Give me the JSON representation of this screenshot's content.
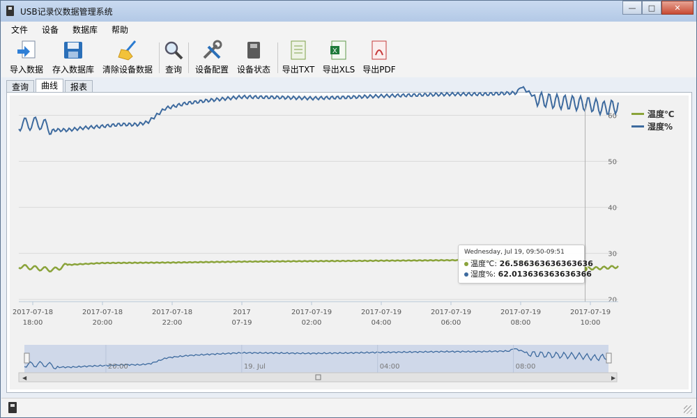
{
  "window": {
    "title": "USB记录仪数据管理系统"
  },
  "menu": [
    "文件",
    "设备",
    "数据库",
    "帮助"
  ],
  "toolbar": {
    "import": "导入数据",
    "save_db": "存入数据库",
    "clear": "清除设备数据",
    "query": "查询",
    "config": "设备配置",
    "status": "设备状态",
    "export_txt": "导出TXT",
    "export_xls": "导出XLS",
    "export_pdf": "导出PDF"
  },
  "tabs": [
    "查询",
    "曲线",
    "报表"
  ],
  "active_tab": "曲线",
  "colors": {
    "temperature": "#8aa33a",
    "humidity": "#3d6a9e"
  },
  "chart_data": {
    "type": "line",
    "series": [
      {
        "name": "温度℃",
        "color": "#8aa33a"
      },
      {
        "name": "湿度%",
        "color": "#3d6a9e"
      }
    ],
    "y_axis": {
      "ticks": [
        20,
        30,
        40,
        50,
        60
      ]
    },
    "x_axis": {
      "ticks": [
        {
          "date": "2017-07-18",
          "time": "18:00"
        },
        {
          "date": "2017-07-18",
          "time": "20:00"
        },
        {
          "date": "2017-07-18",
          "time": "22:00"
        },
        {
          "date": "2017",
          "time": "07-19"
        },
        {
          "date": "2017-07-19",
          "time": "02:00"
        },
        {
          "date": "2017-07-19",
          "time": "04:00"
        },
        {
          "date": "2017-07-19",
          "time": "06:00"
        },
        {
          "date": "2017-07-19",
          "time": "08:00"
        },
        {
          "date": "2017-07-19",
          "time": "10:00"
        }
      ]
    },
    "humidity_samples": [
      {
        "t": 17.6,
        "v": 58
      },
      {
        "t": 18.2,
        "v": 58.3
      },
      {
        "t": 18.6,
        "v": 56.8
      },
      {
        "t": 19.0,
        "v": 56.8
      },
      {
        "t": 19.5,
        "v": 57.3
      },
      {
        "t": 20.0,
        "v": 57.6
      },
      {
        "t": 20.5,
        "v": 58.0
      },
      {
        "t": 21.0,
        "v": 58.0
      },
      {
        "t": 21.3,
        "v": 58.5
      },
      {
        "t": 21.8,
        "v": 61.5
      },
      {
        "t": 22.4,
        "v": 62.6
      },
      {
        "t": 23.0,
        "v": 63.2
      },
      {
        "t": 24.0,
        "v": 64.0
      },
      {
        "t": 25.0,
        "v": 63.9
      },
      {
        "t": 26.0,
        "v": 63.7
      },
      {
        "t": 27.0,
        "v": 63.9
      },
      {
        "t": 28.0,
        "v": 64.2
      },
      {
        "t": 29.0,
        "v": 64.4
      },
      {
        "t": 30.0,
        "v": 64.6
      },
      {
        "t": 31.0,
        "v": 64.6
      },
      {
        "t": 31.9,
        "v": 64.9
      },
      {
        "t": 32.0,
        "v": 66.3
      },
      {
        "t": 32.5,
        "v": 63.5
      },
      {
        "t": 33.0,
        "v": 63.0
      },
      {
        "t": 33.5,
        "v": 62.7
      },
      {
        "t": 34.0,
        "v": 62.4
      },
      {
        "t": 34.4,
        "v": 61.5
      },
      {
        "t": 34.8,
        "v": 62.0
      }
    ],
    "temperature_samples": [
      {
        "t": 17.6,
        "v": 27.2
      },
      {
        "t": 18.2,
        "v": 26.7
      },
      {
        "t": 18.6,
        "v": 26.4
      },
      {
        "t": 19.0,
        "v": 27.5
      },
      {
        "t": 20.0,
        "v": 27.9
      },
      {
        "t": 22.0,
        "v": 28.0
      },
      {
        "t": 24.0,
        "v": 28.2
      },
      {
        "t": 26.0,
        "v": 28.3
      },
      {
        "t": 28.0,
        "v": 28.4
      },
      {
        "t": 30.0,
        "v": 28.5
      },
      {
        "t": 32.0,
        "v": 28.6
      },
      {
        "t": 32.5,
        "v": 27.0
      },
      {
        "t": 33.5,
        "v": 26.6
      },
      {
        "t": 34.3,
        "v": 26.8
      },
      {
        "t": 34.8,
        "v": 27.1
      }
    ],
    "navigator": {
      "labels": [
        "20:00",
        "19. Jul",
        "04:00",
        "08:00"
      ]
    },
    "tooltip": {
      "header": "Wednesday, Jul 19, 09:50-09:51",
      "rows": [
        {
          "name": "温度℃",
          "value": "26.586363636363636",
          "color": "#8aa33a"
        },
        {
          "name": "湿度%",
          "value": "62.013636363636366",
          "color": "#3d6a9e"
        }
      ]
    }
  }
}
